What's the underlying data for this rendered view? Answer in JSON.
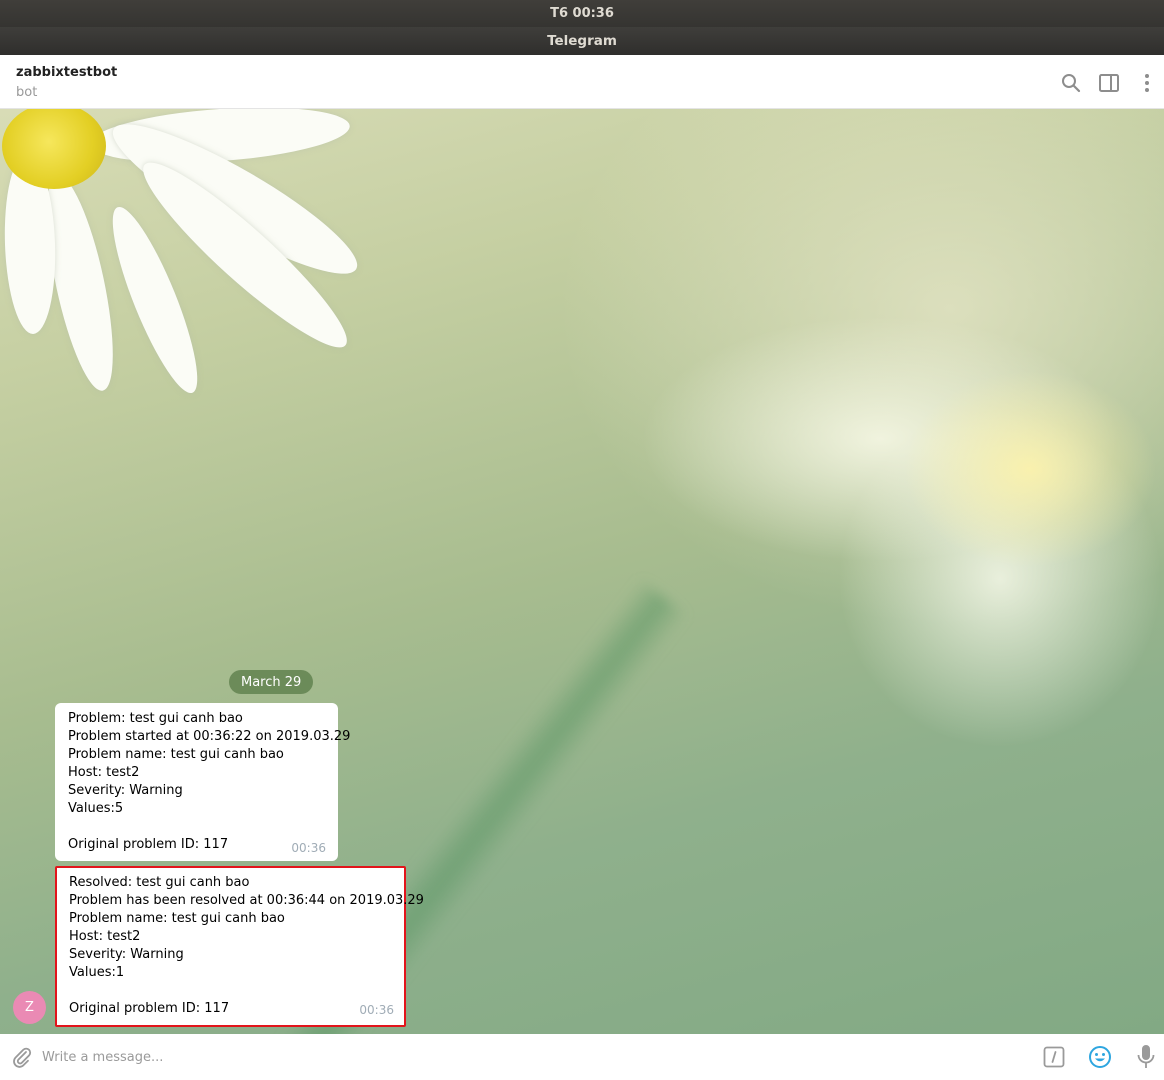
{
  "os": {
    "clock": "T6 00:36"
  },
  "window": {
    "title": "Telegram"
  },
  "chat": {
    "name": "zabbixtestbot",
    "status": "bot",
    "date_label": "March 29",
    "avatar_letter": "Z"
  },
  "messages": [
    {
      "lines": [
        "Problem: test gui canh bao",
        "Problem started at 00:36:22 on 2019.03.29",
        "Problem name: test gui canh bao",
        "Host: test2",
        "Severity: Warning",
        "Values:5",
        "",
        "Original problem ID: 117"
      ],
      "time": "00:36"
    },
    {
      "lines": [
        "Resolved: test gui canh bao",
        "Problem has been resolved at 00:36:44 on 2019.03.29",
        "Problem name: test gui canh bao",
        "Host: test2",
        "Severity: Warning",
        "Values:1",
        "",
        "Original problem ID: 117"
      ],
      "time": "00:36"
    }
  ],
  "compose": {
    "placeholder": "Write a message..."
  },
  "icons": {
    "search": "search-icon",
    "sidebar": "sidebar-toggle-icon",
    "menu": "more-vertical-icon",
    "attach": "paperclip-icon",
    "commands": "bot-commands-icon",
    "emoji": "emoji-icon",
    "voice": "microphone-icon"
  },
  "colors": {
    "accent": "#2ea6e0",
    "highlight_border": "#e2141b",
    "avatar": "#ea8ab4",
    "date_pill": "#618250"
  }
}
